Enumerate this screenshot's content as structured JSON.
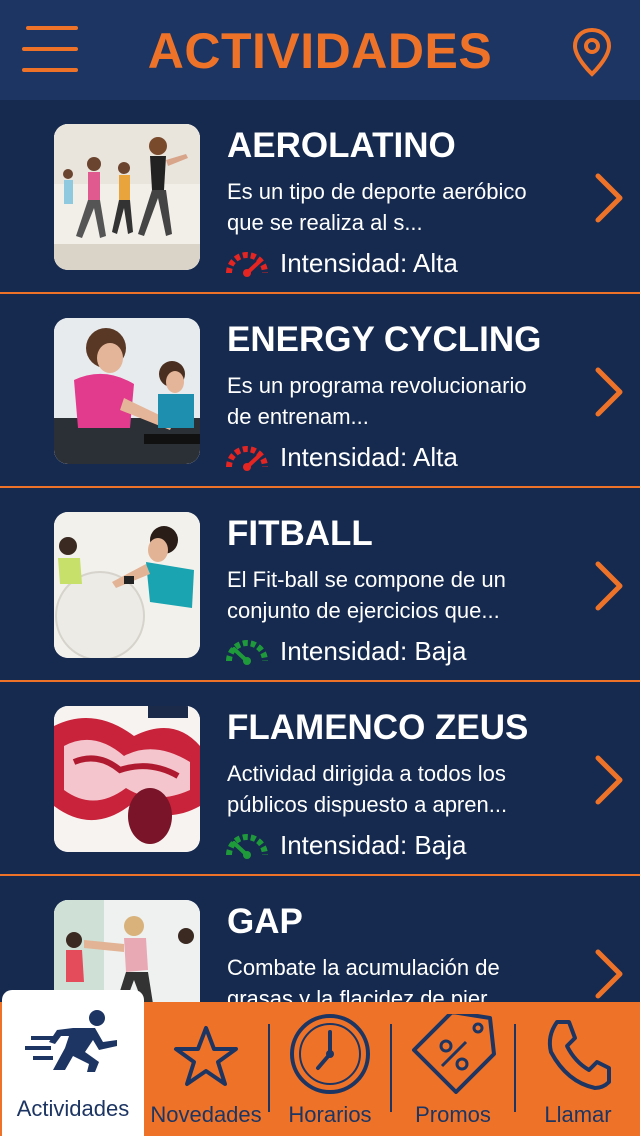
{
  "header": {
    "title": "ACTIVIDADES",
    "menu_icon": "hamburger-menu-icon",
    "location_icon": "map-pin-icon"
  },
  "colors": {
    "accent": "#ee7329",
    "navy": "#1d3563",
    "list_bg": "#162a4f",
    "high": "#e52521",
    "low": "#1f9a3a"
  },
  "activities": [
    {
      "name": "AEROLATINO",
      "description": "Es un tipo de deporte aeróbico que se realiza al s...",
      "intensity": "Intensidad: Alta",
      "level": "high"
    },
    {
      "name": "ENERGY CYCLING",
      "description": "Es un programa revolucionario de entrenam...",
      "intensity": "Intensidad: Alta",
      "level": "high"
    },
    {
      "name": "FITBALL",
      "description": "El Fit-ball se compone de un conjunto de ejercicios que...",
      "intensity": "Intensidad: Baja",
      "level": "low"
    },
    {
      "name": "FLAMENCO ZEUS",
      "description": "Actividad dirigida a todos los públicos dispuesto a apren...",
      "intensity": "Intensidad: Baja",
      "level": "low"
    },
    {
      "name": "GAP",
      "description": "Combate la acumulación de grasas y la flacidez de pier..."
    }
  ],
  "tabs": [
    {
      "label": "Actividades",
      "icon": "running-person-icon",
      "active": true
    },
    {
      "label": "Novedades",
      "icon": "star-icon"
    },
    {
      "label": "Horarios",
      "icon": "clock-icon"
    },
    {
      "label": "Promos",
      "icon": "discount-tag-icon"
    },
    {
      "label": "Llamar",
      "icon": "phone-icon"
    }
  ]
}
